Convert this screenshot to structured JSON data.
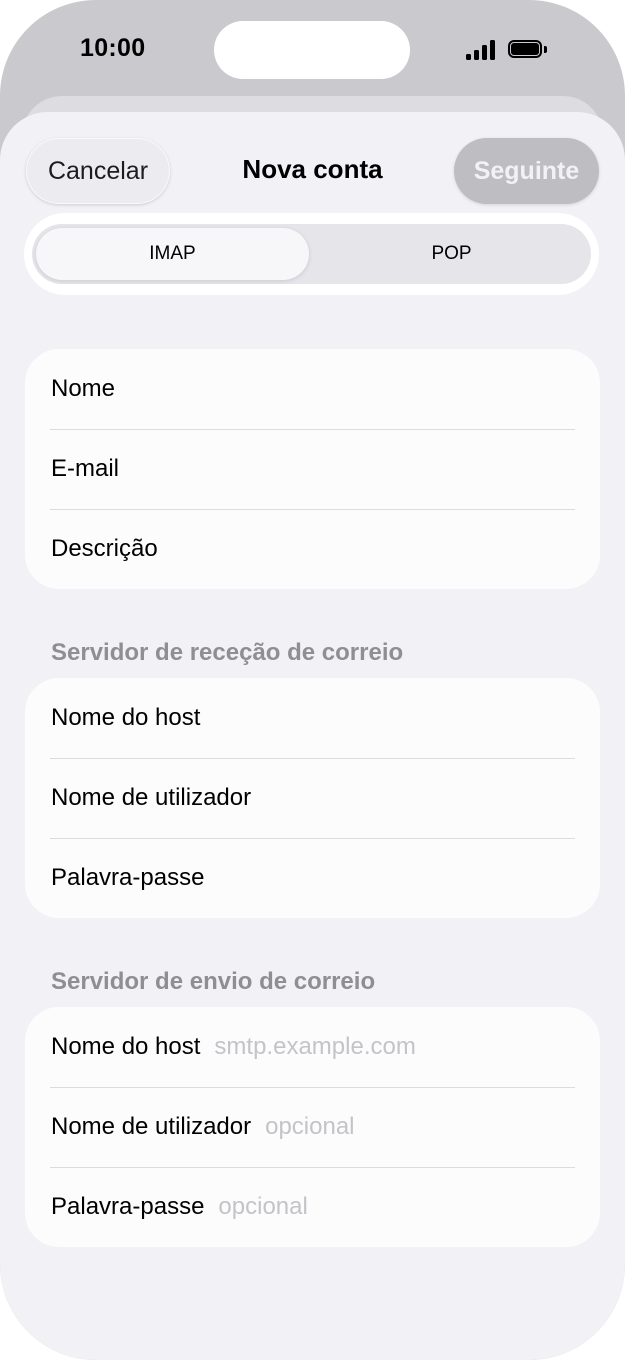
{
  "status_bar": {
    "time": "10:00",
    "signal_icon": "cellular-signal-icon",
    "battery_icon": "battery-full-icon"
  },
  "nav": {
    "cancel_label": "Cancelar",
    "title": "Nova conta",
    "next_label": "Seguinte"
  },
  "segment": {
    "options": [
      "IMAP",
      "POP"
    ],
    "selected": "IMAP"
  },
  "account_fields": [
    {
      "label": "Nome",
      "placeholder": ""
    },
    {
      "label": "E-mail",
      "placeholder": ""
    },
    {
      "label": "Descrição",
      "placeholder": ""
    }
  ],
  "incoming": {
    "header": "Servidor de receção de correio",
    "fields": [
      {
        "label": "Nome do host",
        "placeholder": ""
      },
      {
        "label": "Nome de utilizador",
        "placeholder": ""
      },
      {
        "label": "Palavra-passe",
        "placeholder": ""
      }
    ]
  },
  "outgoing": {
    "header": "Servidor de envio de correio",
    "fields": [
      {
        "label": "Nome do host",
        "placeholder": "smtp.example.com"
      },
      {
        "label": "Nome de utilizador",
        "placeholder": "opcional"
      },
      {
        "label": "Palavra-passe",
        "placeholder": "opcional"
      }
    ]
  },
  "colors": {
    "sheet_background": "#f1f1f6",
    "group_background": "#fcfcfd",
    "section_header": "#8e8e93",
    "placeholder": "#c4c4c8",
    "next_button_disabled": "#bdbdc2"
  }
}
